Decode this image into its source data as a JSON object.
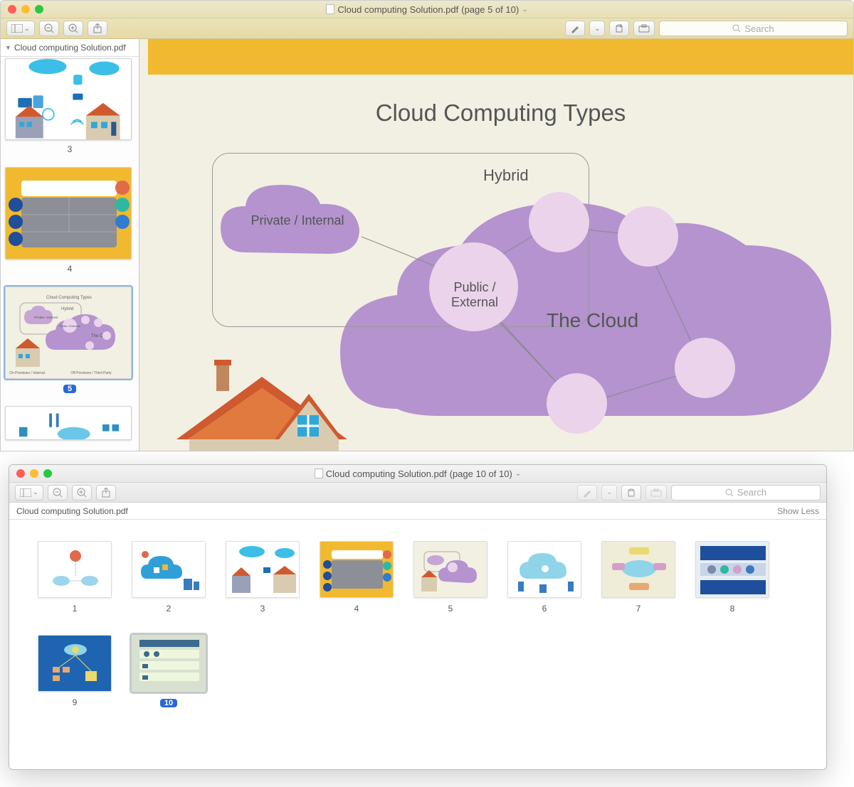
{
  "window_top": {
    "filename": "Cloud computing Solution.pdf",
    "page_label": "(page 5 of 10)",
    "sidebar_header": "Cloud computing Solution.pdf",
    "search_placeholder": "Search",
    "thumbs": {
      "p3_num": "3",
      "p4_num": "4",
      "p5_num": "5"
    },
    "diagram": {
      "title": "Cloud Computing Types",
      "hybrid_label": "Hybrid",
      "private_label": "Private / Internal",
      "public_label": "Public / External",
      "cloud_label": "The Cloud"
    }
  },
  "window_bottom": {
    "filename": "Cloud computing Solution.pdf",
    "page_label": "(page 10 of 10)",
    "header_filename": "Cloud computing Solution.pdf",
    "show_less": "Show Less",
    "search_placeholder": "Search",
    "pages": [
      "1",
      "2",
      "3",
      "4",
      "5",
      "6",
      "7",
      "8",
      "9",
      "10"
    ],
    "selected": "10"
  }
}
